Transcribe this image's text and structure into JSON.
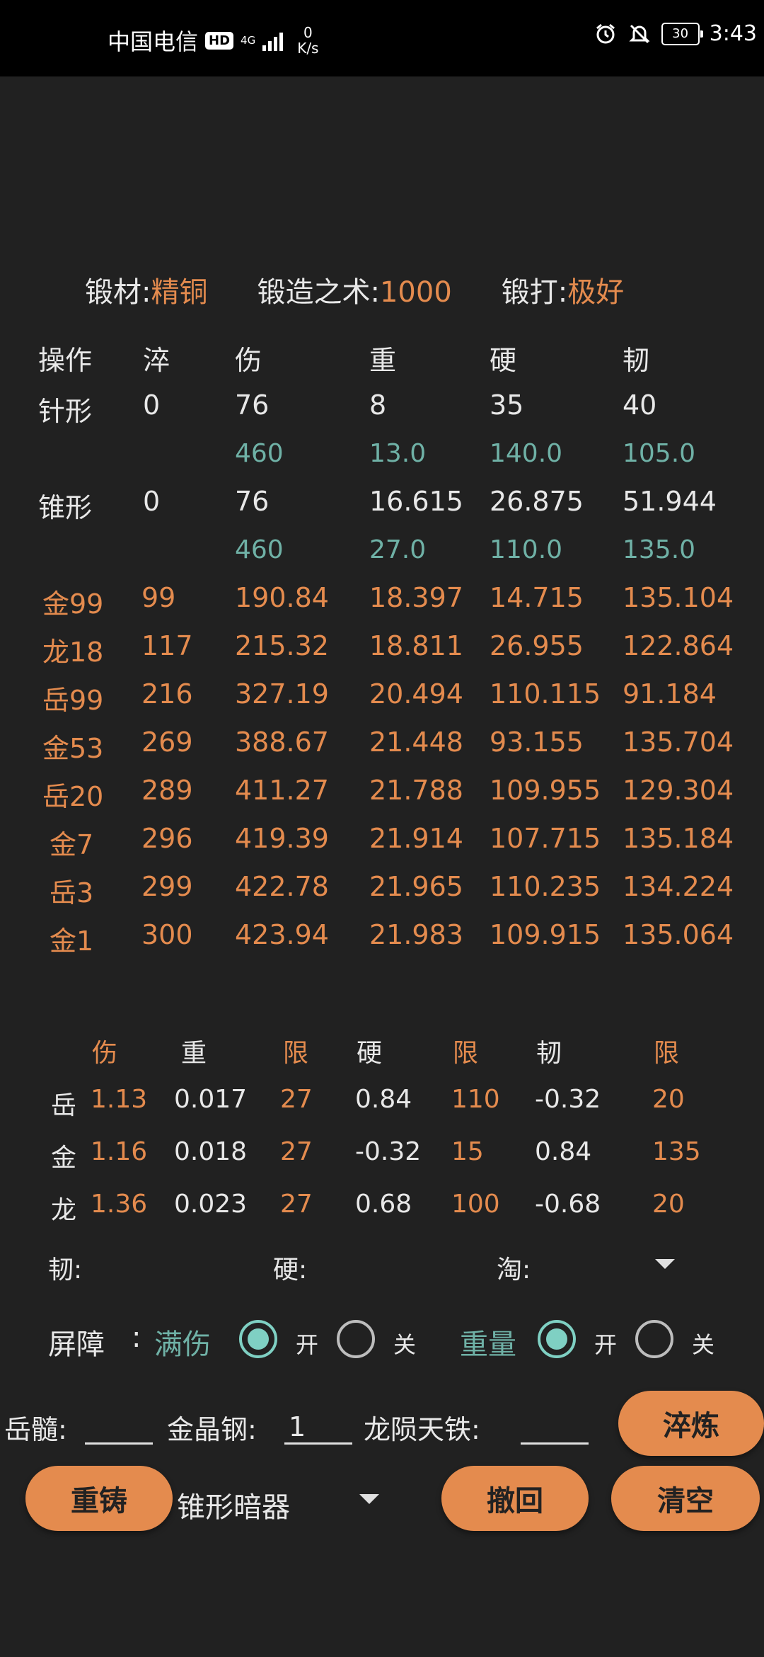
{
  "status_bar": {
    "carrier": "中国电信",
    "hd": "HD",
    "network": "4G",
    "speed_value": "0",
    "speed_unit": "K/s",
    "battery": "30",
    "time": "3:43"
  },
  "info": {
    "material_label": "锻材:",
    "material_value": "精铜",
    "skill_label": "锻造之术:",
    "skill_value": "1000",
    "forge_label": "锻打:",
    "forge_value": "极好"
  },
  "table": {
    "headers": [
      "操作",
      "淬",
      "伤",
      "重",
      "硬",
      "韧"
    ],
    "base_rows": [
      {
        "name": "针形",
        "cells": [
          "0",
          "76",
          "8",
          "35",
          "40"
        ],
        "sub": [
          "460",
          "13.0",
          "140.0",
          "105.0"
        ]
      },
      {
        "name": "锥形",
        "cells": [
          "0",
          "76",
          "16.615",
          "26.875",
          "51.944"
        ],
        "sub": [
          "460",
          "27.0",
          "110.0",
          "135.0"
        ]
      }
    ],
    "ops_rows": [
      {
        "name": "金99",
        "cells": [
          "99",
          "190.84",
          "18.397",
          "14.715",
          "135.104"
        ]
      },
      {
        "name": "龙18",
        "cells": [
          "117",
          "215.32",
          "18.811",
          "26.955",
          "122.864"
        ]
      },
      {
        "name": "岳99",
        "cells": [
          "216",
          "327.19",
          "20.494",
          "110.115",
          "91.184"
        ]
      },
      {
        "name": "金53",
        "cells": [
          "269",
          "388.67",
          "21.448",
          "93.155",
          "135.704"
        ]
      },
      {
        "name": "岳20",
        "cells": [
          "289",
          "411.27",
          "21.788",
          "109.955",
          "129.304"
        ]
      },
      {
        "name": "金7",
        "cells": [
          "296",
          "419.39",
          "21.914",
          "107.715",
          "135.184"
        ]
      },
      {
        "name": "岳3",
        "cells": [
          "299",
          "422.78",
          "21.965",
          "110.235",
          "134.224"
        ]
      },
      {
        "name": "金1",
        "cells": [
          "300",
          "423.94",
          "21.983",
          "109.915",
          "135.064"
        ]
      }
    ]
  },
  "coef": {
    "headers": [
      "伤",
      "重",
      "限",
      "硬",
      "限",
      "韧",
      "限"
    ],
    "rows": [
      {
        "name": "岳",
        "cells": [
          "1.13",
          "0.017",
          "27",
          "0.84",
          "110",
          "-0.32",
          "20"
        ]
      },
      {
        "name": "金",
        "cells": [
          "1.16",
          "0.018",
          "27",
          "-0.32",
          "15",
          "0.84",
          "135"
        ]
      },
      {
        "name": "龙",
        "cells": [
          "1.36",
          "0.023",
          "27",
          "0.68",
          "100",
          "-0.68",
          "20"
        ]
      }
    ]
  },
  "filters": {
    "ren_label": "韧:",
    "ying_label": "硬:",
    "dao_label": "淘:"
  },
  "barrier": {
    "label": "屏障",
    "colon": ":",
    "full_damage": "满伤",
    "weight": "重量",
    "on": "开",
    "off": "关"
  },
  "inputs": {
    "yue_label": "岳髓:",
    "yue_value": "",
    "jin_label": "金晶钢:",
    "jin_value": "1",
    "long_label": "龙陨天铁:",
    "long_value": ""
  },
  "buttons": {
    "quench": "淬炼",
    "recast": "重铸",
    "undo": "撤回",
    "clear": "清空"
  },
  "weapon_select": "锥形暗器"
}
